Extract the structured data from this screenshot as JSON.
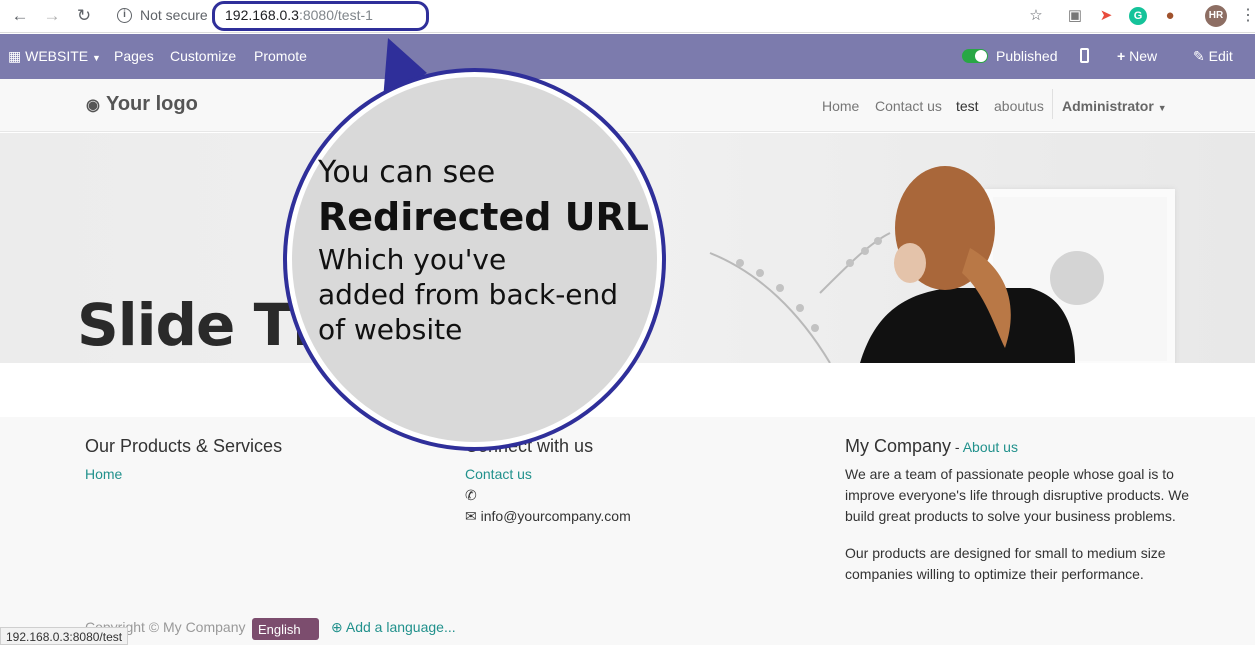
{
  "browser": {
    "security_label": "Not secure",
    "url_host": "192.168.0.3",
    "url_rest": ":8080/test-1",
    "profile_initials": "HR"
  },
  "editbar": {
    "app_menu": "WEBSITE",
    "pages": "Pages",
    "customize": "Customize",
    "promote": "Promote",
    "published": "Published",
    "new": "New",
    "edit": "Edit"
  },
  "site": {
    "logo": "Your logo",
    "nav": [
      "Home",
      "Contact us",
      "test",
      "aboutus"
    ],
    "user": "Administrator"
  },
  "hero": {
    "title": "Slide Tit"
  },
  "callout": {
    "line1": "You can see",
    "line2": "Redirected URL",
    "line3": "Which you've",
    "line4": "added from back-end",
    "line5": "of website"
  },
  "footer": {
    "products_title": "Our Products & Services",
    "products_link": "Home",
    "connect_title": "Connect with us",
    "contact_link": "Contact us",
    "email": "info@yourcompany.com",
    "company_title": "My Company",
    "company_sep": " - ",
    "about_link": "About us",
    "about_p1": "We are a team of passionate people whose goal is to improve everyone's life through disruptive products. We build great products to solve your business problems.",
    "about_p2": "Our products are designed for small to medium size companies willing to optimize their performance.",
    "copyright": "Copyright © My Company",
    "language": "English",
    "add_language": "Add a language..."
  },
  "status_bar": {
    "hover_url": "192.168.0.3:8080/test"
  },
  "colors": {
    "editbar": "#7c7bad",
    "link": "#21918c",
    "callout_border": "#2f2f9a",
    "lang_button": "#7c4d6e"
  }
}
